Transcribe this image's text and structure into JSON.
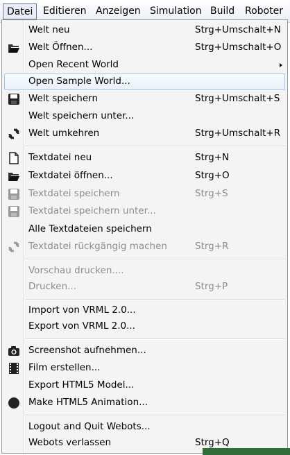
{
  "menubar": {
    "items": [
      "Datei",
      "Editieren",
      "Anzeigen",
      "Simulation",
      "Build",
      "Roboter"
    ]
  },
  "menu": {
    "items": [
      {
        "label": "Welt neu",
        "shortcut": "Strg+Umschalt+N",
        "icon": "none"
      },
      {
        "label": "Welt Öffnen...",
        "shortcut": "Strg+Umschalt+O",
        "icon": "folder-open-icon"
      },
      {
        "label": "Open Recent World",
        "shortcut": "",
        "icon": "none",
        "submenu": true
      },
      {
        "label": "Open Sample World...",
        "shortcut": "",
        "icon": "none",
        "highlighted": true
      },
      {
        "label": "Welt speichern",
        "shortcut": "Strg+Umschalt+S",
        "icon": "save-icon"
      },
      {
        "label": "Welt speichern unter...",
        "shortcut": "",
        "icon": "none"
      },
      {
        "label": "Welt umkehren",
        "shortcut": "Strg+Umschalt+R",
        "icon": "revert-icon"
      },
      {
        "label": "Textdatei neu",
        "shortcut": "Strg+N",
        "icon": "new-file-icon"
      },
      {
        "label": "Textdatei öffnen...",
        "shortcut": "Strg+O",
        "icon": "folder-open-icon"
      },
      {
        "label": "Textdatei speichern",
        "shortcut": "Strg+S",
        "icon": "save-icon",
        "disabled": true
      },
      {
        "label": "Textdatei speichern unter...",
        "shortcut": "",
        "icon": "save-icon",
        "disabled": true
      },
      {
        "label": "Alle Textdateien speichern",
        "shortcut": "",
        "icon": "none"
      },
      {
        "label": "Textdatei rückgängig machen",
        "shortcut": "Strg+R",
        "icon": "revert-icon",
        "disabled": true
      },
      {
        "label": "Vorschau drucken....",
        "shortcut": "",
        "icon": "none",
        "disabled": true
      },
      {
        "label": "Drucken...",
        "shortcut": "Strg+P",
        "icon": "none",
        "disabled": true
      },
      {
        "label": "Import von VRML 2.0...",
        "shortcut": "",
        "icon": "none"
      },
      {
        "label": "Export von VRML 2.0...",
        "shortcut": "",
        "icon": "none"
      },
      {
        "label": "Screenshot aufnehmen...",
        "shortcut": "",
        "icon": "camera-icon"
      },
      {
        "label": "Film erstellen...",
        "shortcut": "",
        "icon": "film-icon"
      },
      {
        "label": "Export HTML5 Model...",
        "shortcut": "",
        "icon": "none"
      },
      {
        "label": "Make HTML5 Animation...",
        "shortcut": "",
        "icon": "record-icon"
      },
      {
        "label": "Logout and Quit Webots...",
        "shortcut": "",
        "icon": "none"
      },
      {
        "label": "Webots verlassen",
        "shortcut": "Strg+Q",
        "icon": "none"
      }
    ]
  }
}
